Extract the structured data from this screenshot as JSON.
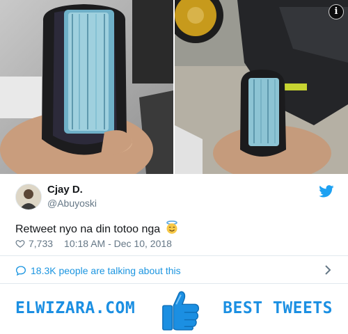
{
  "tweet": {
    "author_name": "Cjay D.",
    "author_handle": "@Abuyoski",
    "text": "Retweet nyo na din totoo nga",
    "emoji_icon": "smiling-face-with-halo-emoji",
    "likes": "7,733",
    "timestamp": "10:18 AM - Dec 10, 2018",
    "talking": "18.3K people are talking about this"
  },
  "footer": {
    "brand": "ELWIZARA.COM",
    "tagline": "BEST TWEETS",
    "icon": "thumbs-up-icon"
  },
  "colors": {
    "twitter_blue": "#1da1f2",
    "link_blue": "#1b95e0",
    "footer_blue": "#1b8fe2",
    "muted": "#657786"
  }
}
